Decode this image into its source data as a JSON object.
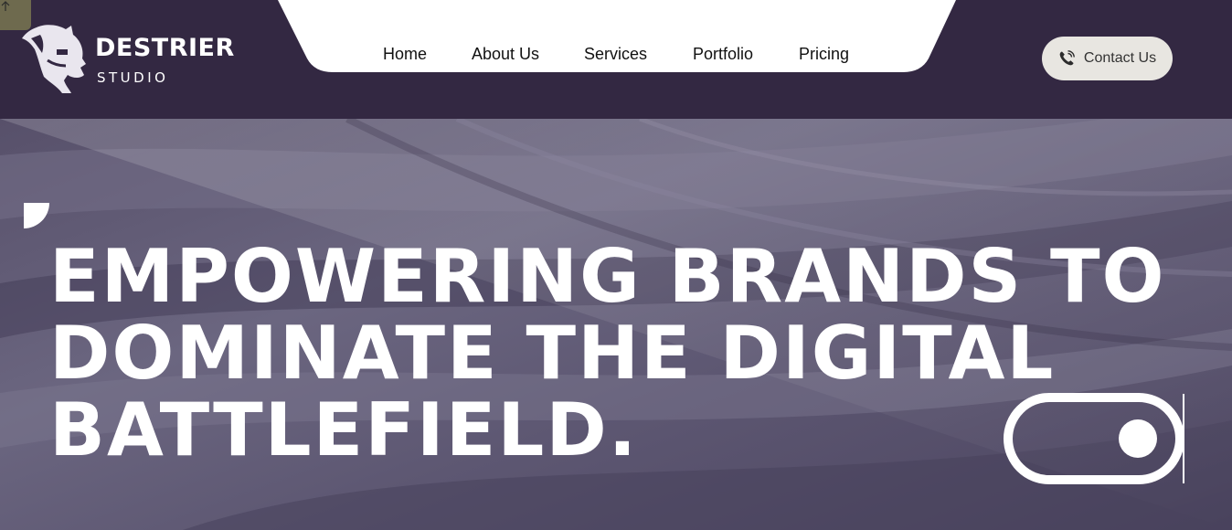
{
  "brand": {
    "name": "DESTRIER",
    "subtitle": "STUDIO"
  },
  "nav": {
    "items": [
      {
        "label": "Home"
      },
      {
        "label": "About Us"
      },
      {
        "label": "Services"
      },
      {
        "label": "Portfolio"
      },
      {
        "label": "Pricing"
      }
    ]
  },
  "contact": {
    "label": "Contact Us",
    "icon": "phone-icon"
  },
  "hero": {
    "headline_lines": [
      "EMPOWERING BRANDS TO",
      "DOMINATE THE DIGITAL",
      "BATTLEFIELD."
    ],
    "toggle_state": "on"
  },
  "colors": {
    "header_bg": "#332842",
    "nav_pill": "#ffffff",
    "contact_bg": "#e8e6e1",
    "hero_tint": "#5d5772"
  }
}
